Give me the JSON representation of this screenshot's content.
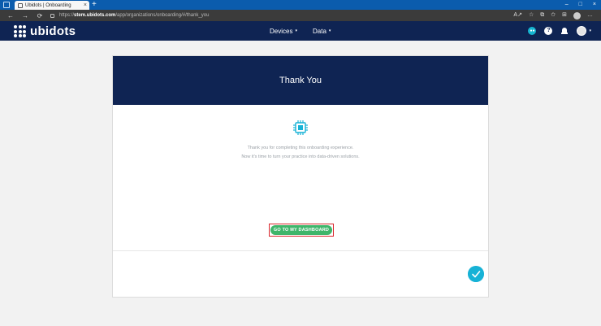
{
  "browser": {
    "tab_title": "Ubidots | Onboarding",
    "tab_close": "×",
    "new_tab": "+",
    "window_controls": [
      "–",
      "□",
      "×"
    ],
    "nav": {
      "back": "←",
      "forward": "→",
      "reload": "⟳"
    },
    "url_prefix": "https://",
    "url_host": "stem.ubidots.com",
    "url_path": "/app/organizations/onboarding/#/thank_you",
    "toolbar_icons": [
      "read-aloud-icon",
      "favorite-icon",
      "extensions-icon",
      "favorites-bar-icon",
      "collections-icon",
      "profile-icon",
      "more-icon"
    ],
    "toolbar_glyphs": [
      "A↗",
      "☆",
      "⧉",
      "✩",
      "⊞"
    ],
    "more_glyph": "…"
  },
  "app": {
    "logo_text": "ubidots",
    "menu": [
      {
        "label": "Devices",
        "caret": "▾"
      },
      {
        "label": "Data",
        "caret": "▾"
      }
    ],
    "header_icons": [
      "badge-icon",
      "help-icon",
      "bell-icon",
      "avatar"
    ],
    "badge_glyph": "●●",
    "help_glyph": "?",
    "avatar_caret": "▾"
  },
  "card": {
    "title": "Thank You",
    "icon": "chip-icon",
    "message_line1": "Thank you for completing this onboarding experience.",
    "message_line2": "Now it's time to turn your practice into data-driven solutions.",
    "button_label": "GO TO MY DASHBOARD",
    "complete_icon": "check-icon"
  },
  "colors": {
    "navy": "#0f2453",
    "accent_cyan": "#17b2d6",
    "button_green": "#3fb56a",
    "highlight_red": "#d9262c",
    "browser_blue": "#0b5cad"
  }
}
